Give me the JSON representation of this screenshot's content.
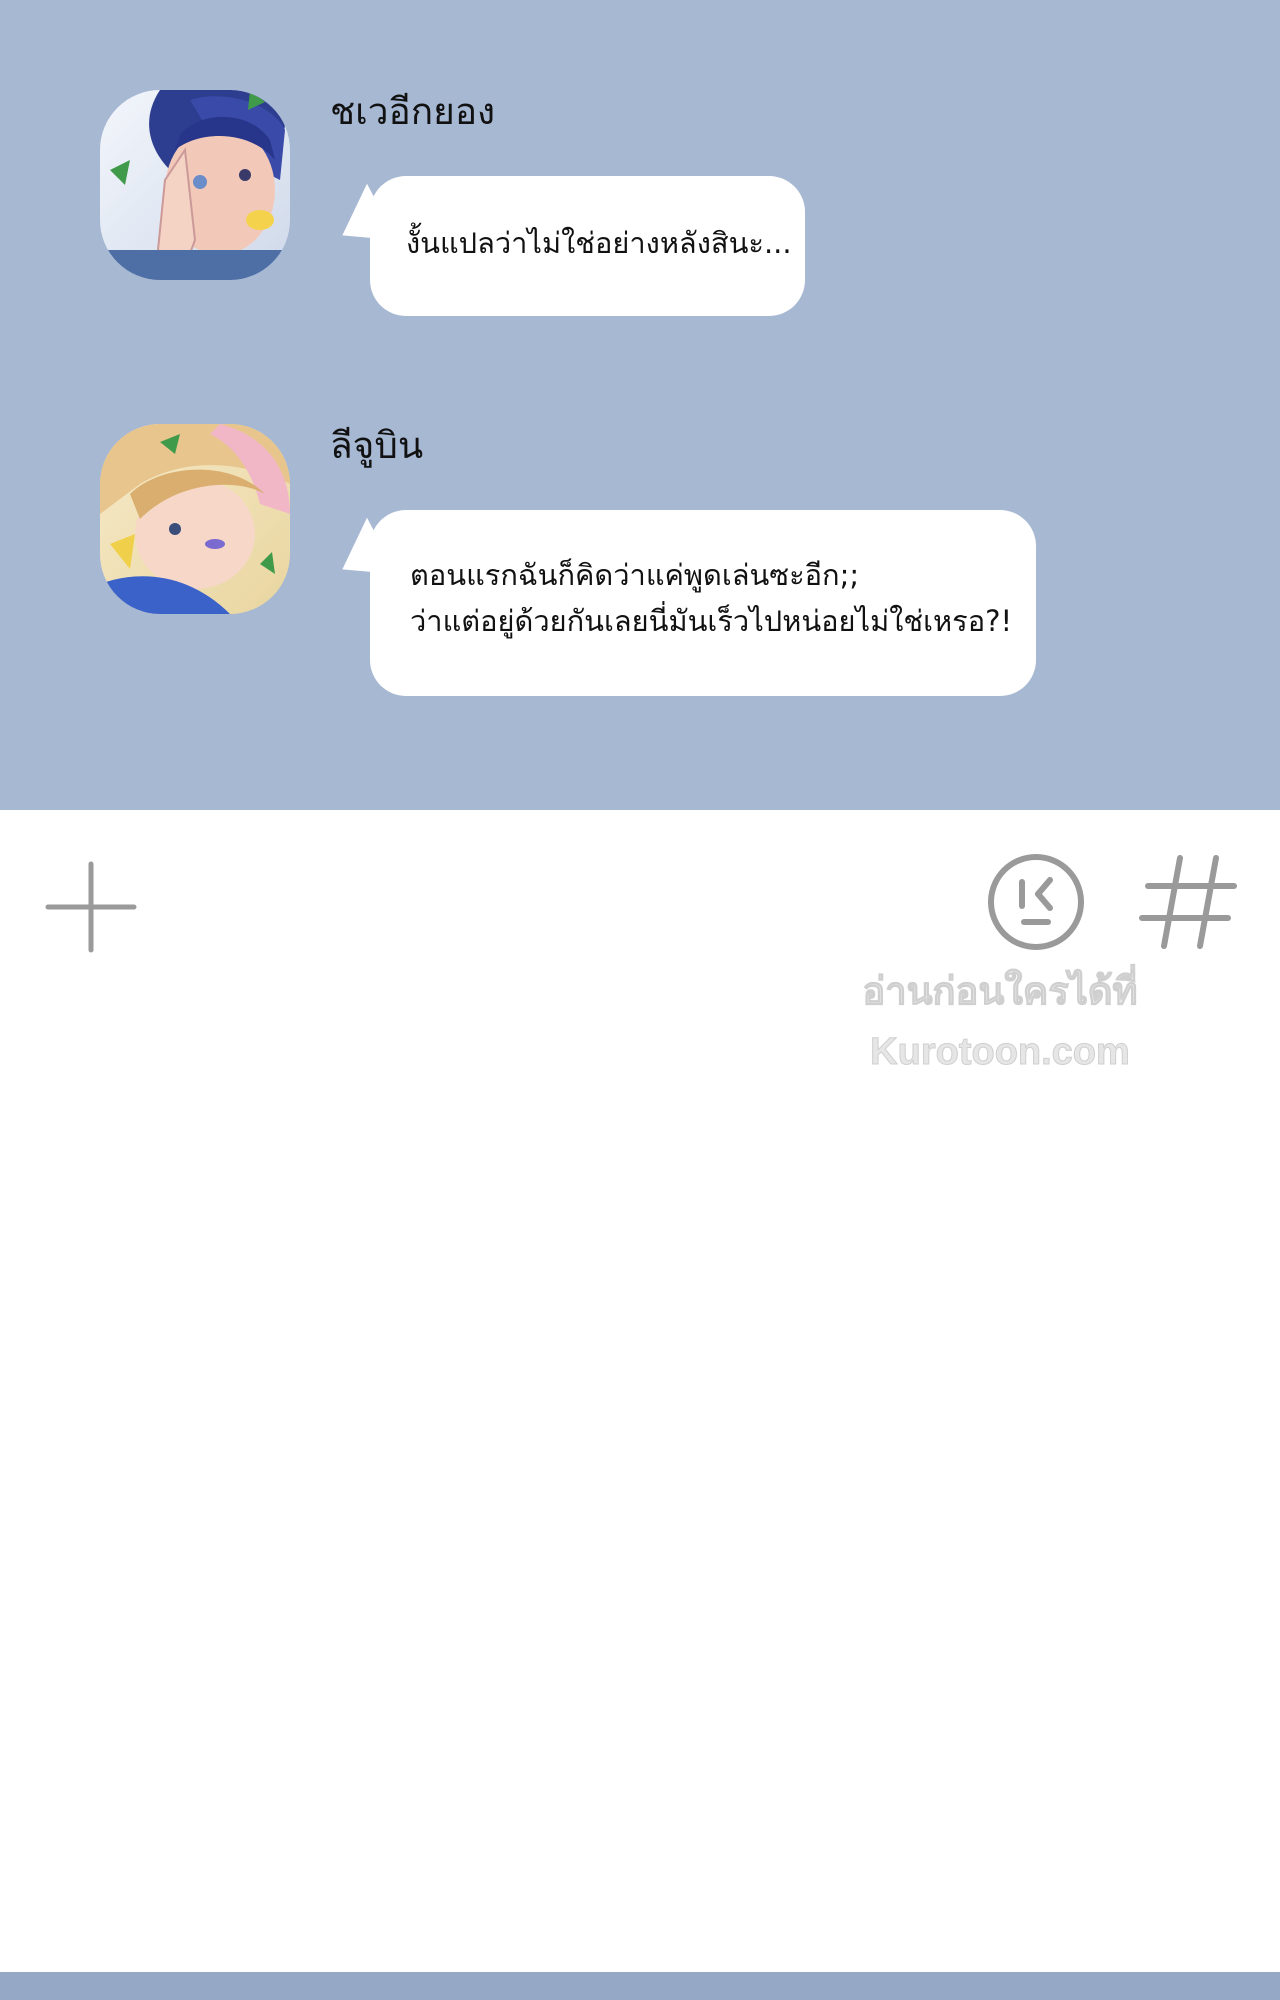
{
  "chat": {
    "messages": [
      {
        "sender": "ชเวอีกยอง",
        "lines": [
          "งั้นแปลว่าไม่ใช่อย่างหลังสินะ..."
        ],
        "avatar_icon": "avatar-dark-hair"
      },
      {
        "sender": "ลีจูบิน",
        "lines": [
          "ตอนแรกฉันก็คิดว่าแค่พูดเล่นซะอีก;;",
          "ว่าแต่อยู่ด้วยกันเลยนี่มันเร็วไปหน่อยไม่ใช่เหรอ?!"
        ],
        "avatar_icon": "avatar-blond-hair"
      }
    ]
  },
  "input_bar": {
    "add_icon": "plus-icon",
    "emoji_icon": "emoji-icon",
    "hash_icon": "hash-icon"
  },
  "watermark": {
    "line1": "อ่านก่อนใครได้ที่",
    "line2": "Kurotoon.com"
  },
  "colors": {
    "chat_background": "#a7b8d3",
    "bubble": "#ffffff",
    "icon_gray": "#9a9a9a",
    "bottom_strip": "#95a8c6"
  }
}
